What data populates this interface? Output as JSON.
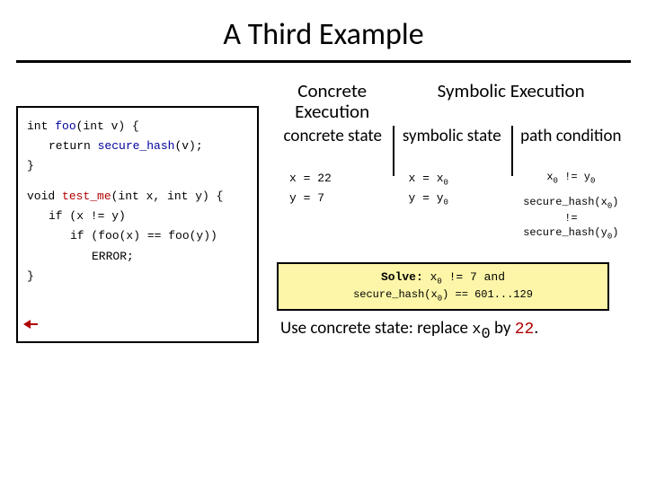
{
  "title": "A Third Example",
  "code": {
    "l1a": "int ",
    "l1b": "foo",
    "l1c": "(int v) {",
    "l2a": "return ",
    "l2b": "secure_hash",
    "l2c": "(v);",
    "l3": "}",
    "l4a": "void ",
    "l4b": "test_me",
    "l4c": "(int x, int y) {",
    "l5": "if (x != y)",
    "l6": "if (foo(x) == foo(y))",
    "l7": "ERROR;",
    "l8": "}"
  },
  "headers": {
    "concrete": "Concrete Execution",
    "symbolic": "Symbolic Execution"
  },
  "subheaders": {
    "cstate": "concrete state",
    "sstate": "symbolic state",
    "pcond": "path condition"
  },
  "rows": {
    "r1c1": "x = 22",
    "r1c2a": "x = x",
    "r1c2sub": "0",
    "r2c1": "y = 7",
    "r2c2a": "y = y",
    "r2c2sub": "0",
    "p1a": "x",
    "p1sub": "0",
    "p1b": " != y",
    "p1sub2": "0",
    "p2a": "secure_hash(x",
    "p2sub": "0",
    "p2b": ")",
    "p3": "!=",
    "p4a": "secure_hash(y",
    "p4sub": "0",
    "p4b": ")"
  },
  "solve": {
    "label": "Solve: ",
    "l1a": "x",
    "l1sub": "0",
    "l1b": " != 7 and",
    "l2a": "secure_hash(x",
    "l2sub": "0",
    "l2b": ") == 601...129"
  },
  "use": {
    "t1": "Use concrete state: replace ",
    "t2": "x",
    "t2sub": "0",
    "t3": " by ",
    "t4": "22",
    "t5": "."
  }
}
